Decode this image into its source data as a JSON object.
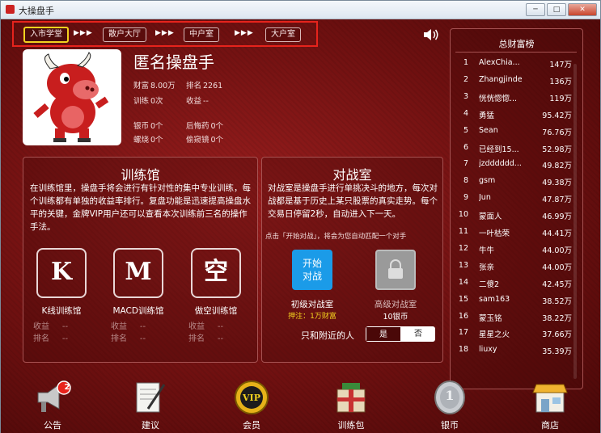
{
  "window": {
    "title": "大操盘手",
    "minimize": "─",
    "maximize": "□",
    "close": "✕"
  },
  "nav": {
    "items": [
      "入市学堂",
      "散户大厅",
      "中户室",
      "大户室"
    ],
    "arrows": "▶▶▶"
  },
  "profile": {
    "name": "匿名操盘手",
    "wealth_label": "财富",
    "wealth_value": "8.00万",
    "rank_label": "排名",
    "rank_value": "2261",
    "train_label": "训练",
    "train_value": "0次",
    "income_label": "收益",
    "income_value": "--",
    "silver_label": "银币",
    "silver_value": "0个",
    "regret_label": "后悔药",
    "regret_value": "0个",
    "firefly_label": "螺烧",
    "firefly_value": "0个",
    "peek_label": "偷窥镜",
    "peek_value": "0个"
  },
  "training": {
    "title": "训练馆",
    "description": "在训练馆里，操盘手将会进行有针对性的集中专业训练，每个训练都有单独的收益率排行。复盘功能是迅速提高操盘水平的关键，金牌VIP用户还可以查看本次训练前三名的操作手法。",
    "rooms": [
      {
        "symbol": "K",
        "name": "K线训练馆",
        "income_label": "收益",
        "income": "--",
        "rank_label": "排名",
        "rank": "--"
      },
      {
        "symbol": "M",
        "name": "MACD训练馆",
        "income_label": "收益",
        "income": "--",
        "rank_label": "排名",
        "rank": "--"
      },
      {
        "symbol": "空",
        "name": "做空训练馆",
        "income_label": "收益",
        "income": "--",
        "rank_label": "排名",
        "rank": "--"
      }
    ]
  },
  "battle": {
    "title": "对战室",
    "description": "对战室是操盘手进行单挑决斗的地方，每次对战都是基于历史上某只股票的真实走势。每个交易日停留2秒，自动进入下一天。",
    "hint": "点击「开始对战」，将会为您自动匹配一个对手",
    "start_button": "开始对战",
    "junior_name": "初级对战室",
    "junior_stake": "押注：1万财富",
    "senior_name": "高级对战室",
    "senior_stake": "10银币",
    "nearby_label": "只和附近的人",
    "toggle_yes": "是",
    "toggle_no": "否"
  },
  "leaderboard": {
    "title": "总财富榜",
    "rows": [
      {
        "rank": "1",
        "name": "AlexChia...",
        "value": "147万"
      },
      {
        "rank": "2",
        "name": "Zhangjinde",
        "value": "136万"
      },
      {
        "rank": "3",
        "name": "恍恍惚惚...",
        "value": "119万"
      },
      {
        "rank": "4",
        "name": "勇猛",
        "value": "95.42万"
      },
      {
        "rank": "5",
        "name": "Sean",
        "value": "76.76万"
      },
      {
        "rank": "6",
        "name": "已经到15...",
        "value": "52.98万"
      },
      {
        "rank": "7",
        "name": "jzdddddd...",
        "value": "49.82万"
      },
      {
        "rank": "8",
        "name": "gsm",
        "value": "49.38万"
      },
      {
        "rank": "9",
        "name": "Jun",
        "value": "47.87万"
      },
      {
        "rank": "10",
        "name": "蒙面人",
        "value": "46.99万"
      },
      {
        "rank": "11",
        "name": "一叶枯荣",
        "value": "44.41万"
      },
      {
        "rank": "12",
        "name": "牛牛",
        "value": "44.00万"
      },
      {
        "rank": "13",
        "name": "张亲",
        "value": "44.00万"
      },
      {
        "rank": "14",
        "name": "二傻2",
        "value": "42.45万"
      },
      {
        "rank": "15",
        "name": "sam163",
        "value": "38.52万"
      },
      {
        "rank": "16",
        "name": "蒙玉铭",
        "value": "38.22万"
      },
      {
        "rank": "17",
        "name": "星星之火",
        "value": "37.66万"
      },
      {
        "rank": "18",
        "name": "liuxy",
        "value": "35.39万"
      }
    ]
  },
  "bottom": {
    "items": [
      {
        "label": "公告",
        "badge": "2"
      },
      {
        "label": "建议"
      },
      {
        "label": "会员",
        "icon_text": "VIP"
      },
      {
        "label": "训练包"
      },
      {
        "label": "银币",
        "icon_text": "1"
      },
      {
        "label": "商店"
      }
    ]
  },
  "colors": {
    "accent_red": "#e6231c",
    "gold": "#f3d21f",
    "start_blue": "#1b9be8"
  }
}
